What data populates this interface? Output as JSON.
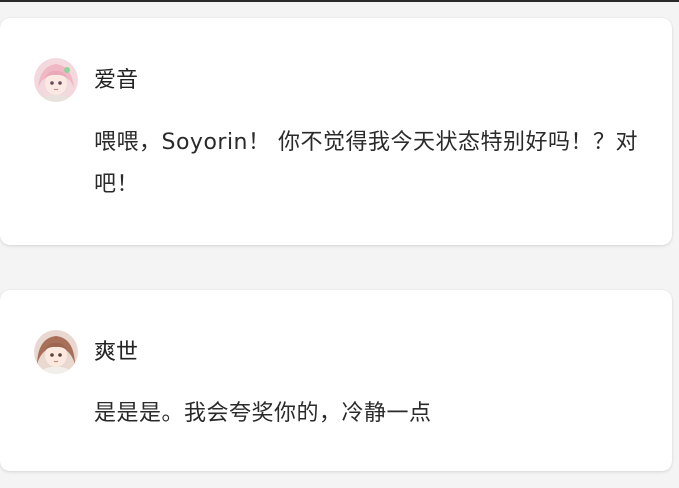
{
  "messages": [
    {
      "author": "爱音",
      "avatar": "anon-avatar-icon",
      "text": "喂喂，Soyorin！ 你不觉得我今天状态特别好吗！？对吧！"
    },
    {
      "author": "爽世",
      "avatar": "soyo-avatar-icon",
      "text": "是是是。我会夸奖你的，冷静一点"
    }
  ],
  "colors": {
    "background": "#f4f4f4",
    "card": "#ffffff",
    "text": "#2a2a2a"
  }
}
